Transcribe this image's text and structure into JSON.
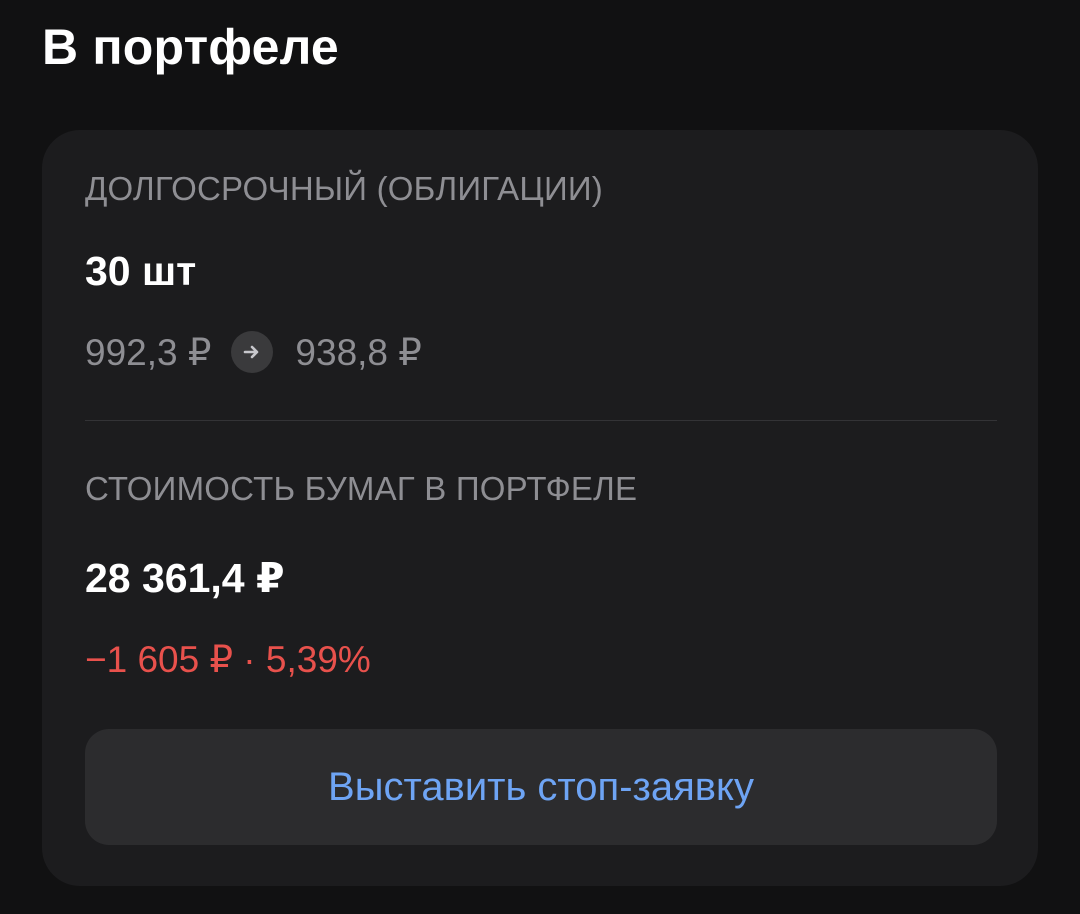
{
  "header": {
    "title": "В портфеле"
  },
  "card": {
    "strategy_label": "ДОЛГОСРОЧНЫЙ (ОБЛИГАЦИИ)",
    "quantity": "30 шт",
    "price_from": "992,3 ₽",
    "price_to": "938,8 ₽",
    "arrow_icon": "arrow-right-icon",
    "value_label": "СТОИМОСТЬ БУМАГ В ПОРТФЕЛЕ",
    "value": "28 361,4 ₽",
    "change": "−1 605 ₽ · 5,39%",
    "stop_order_button": "Выставить стоп-заявку"
  },
  "colors": {
    "background": "#111112",
    "card": "#1c1c1e",
    "button": "#2c2c2e",
    "secondary_text": "#8e8e93",
    "negative": "#e8514c",
    "accent": "#6ea4f4"
  }
}
